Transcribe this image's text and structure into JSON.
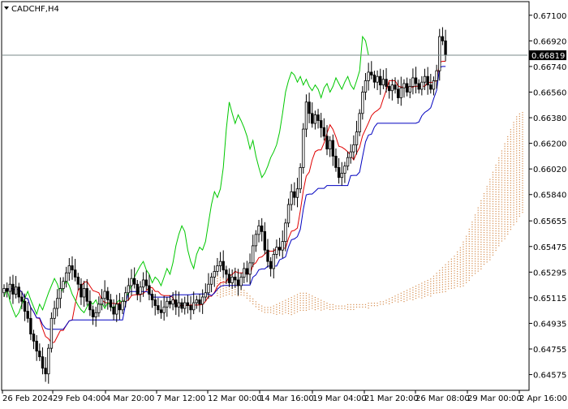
{
  "window": {
    "symbol_label": "CADCHF,H4",
    "current_price_label": "0.66819"
  },
  "colors": {
    "background": "#ffffff",
    "frame": "#000000",
    "candle": "#000000",
    "tenkan": "#e00000",
    "kijun": "#0000c0",
    "chikou": "#00c800",
    "cloud_bull": "#d48a4a",
    "cloud_bear": "#b8b8cc",
    "price_line": "#7a8a8a"
  },
  "chart_data": {
    "type": "candlestick",
    "title": "CADCHF,H4",
    "indicator": "Ichimoku Kinko Hyo",
    "grid": false,
    "ylim": [
      0.6447,
      0.6719
    ],
    "y_ticks": [
      "0.67100",
      "0.66920",
      "0.66740",
      "0.66560",
      "0.66380",
      "0.66200",
      "0.66020",
      "0.65840",
      "0.65655",
      "0.65475",
      "0.65295",
      "0.65115",
      "0.64935",
      "0.64755",
      "0.64575"
    ],
    "x_tick_labels": [
      "26 Feb 2024",
      "29 Feb 04:00",
      "4 Mar 20:00",
      "7 Mar 12:00",
      "12 Mar 00:00",
      "14 Mar 16:00",
      "19 Mar 04:00",
      "21 Mar 20:00",
      "26 Mar 08:00",
      "29 Mar 00:00",
      "2 Apr 16:00"
    ],
    "current_price": 0.66819,
    "close": [
      0.6518,
      0.6516,
      0.6521,
      0.6514,
      0.6519,
      0.6512,
      0.6509,
      0.6502,
      0.6497,
      0.6486,
      0.6481,
      0.6474,
      0.647,
      0.6462,
      0.6458,
      0.6476,
      0.6497,
      0.6504,
      0.6511,
      0.6518,
      0.6523,
      0.6529,
      0.6534,
      0.6531,
      0.6526,
      0.6521,
      0.6512,
      0.6518,
      0.6509,
      0.6503,
      0.6498,
      0.6501,
      0.6507,
      0.6511,
      0.6516,
      0.651,
      0.6505,
      0.65,
      0.6507,
      0.6503,
      0.6509,
      0.6515,
      0.652,
      0.6525,
      0.6521,
      0.6514,
      0.6519,
      0.6524,
      0.652,
      0.6514,
      0.651,
      0.6506,
      0.6503,
      0.6501,
      0.6505,
      0.6509,
      0.6507,
      0.651,
      0.6505,
      0.6508,
      0.6504,
      0.6508,
      0.6506,
      0.6503,
      0.6508,
      0.651,
      0.6507,
      0.6512,
      0.6515,
      0.6521,
      0.6526,
      0.653,
      0.6534,
      0.6537,
      0.6531,
      0.6528,
      0.6522,
      0.6526,
      0.6524,
      0.652,
      0.6526,
      0.6532,
      0.6528,
      0.6536,
      0.6548,
      0.6556,
      0.6562,
      0.6558,
      0.6545,
      0.6537,
      0.6532,
      0.6542,
      0.6547,
      0.6545,
      0.6551,
      0.6564,
      0.6577,
      0.6586,
      0.6582,
      0.6588,
      0.6603,
      0.663,
      0.6649,
      0.6641,
      0.6634,
      0.664,
      0.6636,
      0.6631,
      0.6625,
      0.6616,
      0.6622,
      0.6611,
      0.6603,
      0.6596,
      0.6599,
      0.6604,
      0.661,
      0.6614,
      0.6619,
      0.6628,
      0.6641,
      0.6656,
      0.6664,
      0.667,
      0.6668,
      0.6663,
      0.6667,
      0.6661,
      0.6665,
      0.666,
      0.6657,
      0.6661,
      0.6658,
      0.6652,
      0.6659,
      0.6662,
      0.6656,
      0.666,
      0.6666,
      0.6662,
      0.6658,
      0.6663,
      0.6667,
      0.6661,
      0.6658,
      0.6664,
      0.6671,
      0.6695,
      0.6692,
      0.6682
    ],
    "cloud": {
      "description": "Senkou span A/B band shifted 26 bars ahead; bullish (orange) from mid chart onward",
      "span_a": [
        0.6527,
        0.6526,
        0.6525,
        0.6524,
        0.6523,
        0.6522,
        0.6521,
        0.652,
        0.6519,
        0.6517,
        0.6515,
        0.6513,
        0.6511,
        0.6509,
        0.6507,
        0.6506,
        0.6505,
        0.6505,
        0.6505,
        0.6506,
        0.6507,
        0.6508,
        0.6509,
        0.651,
        0.6511,
        0.6512,
        0.6513,
        0.6514,
        0.6515,
        0.6515,
        0.6515,
        0.6514,
        0.6513,
        0.6512,
        0.6511,
        0.651,
        0.6509,
        0.6508,
        0.6507,
        0.6507,
        0.6506,
        0.6506,
        0.6506,
        0.6506,
        0.6507,
        0.6507,
        0.6507,
        0.6507,
        0.6507,
        0.6507,
        0.6507,
        0.6508,
        0.6508,
        0.6508,
        0.6508,
        0.6509,
        0.6509,
        0.651,
        0.6511,
        0.6512,
        0.6513,
        0.6514,
        0.6515,
        0.6516,
        0.6517,
        0.6518,
        0.6519,
        0.652,
        0.6521,
        0.6522,
        0.6523,
        0.6524,
        0.6525,
        0.6527,
        0.6529,
        0.6531,
        0.6533,
        0.6535,
        0.6537,
        0.6539,
        0.6541,
        0.6544,
        0.6547,
        0.6551,
        0.6555,
        0.656,
        0.6565,
        0.657,
        0.6575,
        0.658,
        0.6585,
        0.659,
        0.6595,
        0.66,
        0.6605,
        0.661,
        0.6615,
        0.662,
        0.6625,
        0.663,
        0.6635,
        0.6639,
        0.6641,
        0.6642
      ],
      "span_b": [
        0.6512,
        0.6512,
        0.6512,
        0.6513,
        0.6513,
        0.6513,
        0.6513,
        0.6513,
        0.6513,
        0.6512,
        0.651,
        0.6508,
        0.6506,
        0.6504,
        0.6502,
        0.6501,
        0.65,
        0.65,
        0.65,
        0.65,
        0.65,
        0.65,
        0.65,
        0.65,
        0.65,
        0.65,
        0.6501,
        0.6501,
        0.6502,
        0.6503,
        0.6503,
        0.6503,
        0.6503,
        0.6503,
        0.6503,
        0.6503,
        0.6503,
        0.6503,
        0.6503,
        0.6503,
        0.6503,
        0.6503,
        0.6503,
        0.6503,
        0.6503,
        0.6503,
        0.6503,
        0.6504,
        0.6504,
        0.6504,
        0.6504,
        0.6504,
        0.6505,
        0.6505,
        0.6505,
        0.6506,
        0.6507,
        0.6507,
        0.6507,
        0.6508,
        0.6508,
        0.6508,
        0.6509,
        0.6509,
        0.6509,
        0.651,
        0.651,
        0.651,
        0.6511,
        0.6511,
        0.6512,
        0.6513,
        0.6513,
        0.6514,
        0.6515,
        0.6515,
        0.6515,
        0.6516,
        0.6517,
        0.6518,
        0.6518,
        0.6519,
        0.6519,
        0.652,
        0.6522,
        0.6524,
        0.6526,
        0.6528,
        0.653,
        0.6532,
        0.6534,
        0.6536,
        0.6538,
        0.6541,
        0.6544,
        0.6547,
        0.655,
        0.6553,
        0.6556,
        0.6559,
        0.6562,
        0.6565,
        0.6568,
        0.6571
      ]
    }
  }
}
